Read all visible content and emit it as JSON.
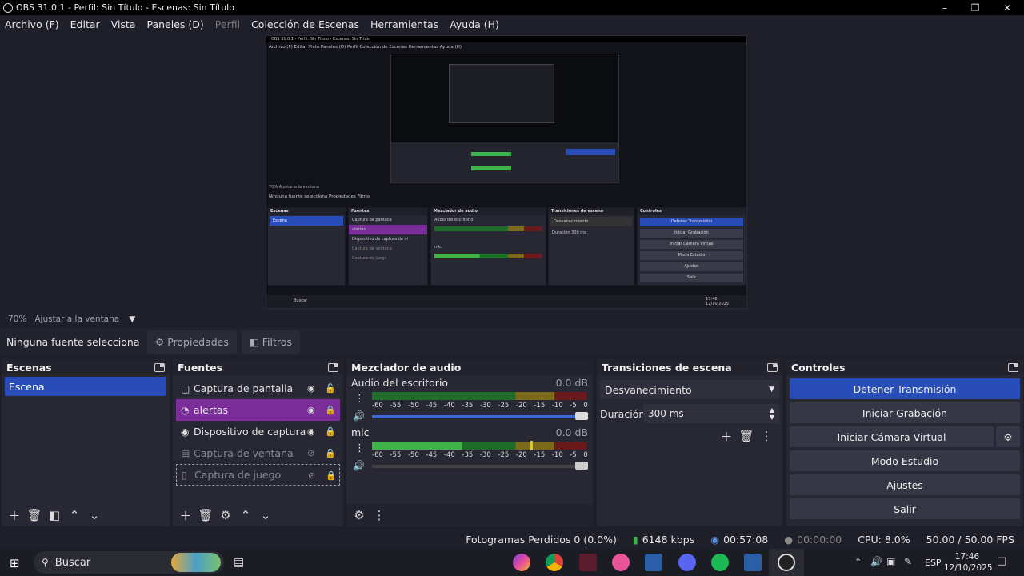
{
  "window": {
    "title": "OBS 31.0.1 - Perfil: Sin Título - Escenas: Sin Título"
  },
  "menu": [
    "Archivo (F)",
    "Editar",
    "Vista",
    "Paneles (D)",
    "Perfil",
    "Colección de Escenas",
    "Herramientas",
    "Ayuda (H)"
  ],
  "menu_disabled_index": 4,
  "preview": {
    "zoom": "70%",
    "fit": "Ajustar a la ventana"
  },
  "source_bar": {
    "label": "Ninguna fuente selecciona",
    "properties": "Propiedades",
    "filters": "Filtros"
  },
  "scenes": {
    "title": "Escenas",
    "items": [
      "Escena"
    ]
  },
  "sources": {
    "title": "Fuentes",
    "items": [
      {
        "label": "Captura de pantalla",
        "icon": "monitor-icon",
        "visible": true,
        "locked": false,
        "selected": false
      },
      {
        "label": "alertas",
        "icon": "globe-icon",
        "visible": true,
        "locked": true,
        "selected": true
      },
      {
        "label": "Dispositivo de captura de vi",
        "icon": "camera-icon",
        "visible": true,
        "locked": true,
        "selected": false
      },
      {
        "label": "Captura de ventana",
        "icon": "window-icon",
        "visible": false,
        "locked": true,
        "selected": false
      },
      {
        "label": "Captura de juego",
        "icon": "gamepad-icon",
        "visible": false,
        "locked": true,
        "selected": false
      }
    ]
  },
  "mixer": {
    "title": "Mezclador de audio",
    "ticks": [
      "-60",
      "-55",
      "-50",
      "-45",
      "-40",
      "-35",
      "-30",
      "-25",
      "-20",
      "-15",
      "-10",
      "-5",
      "0"
    ],
    "channels": [
      {
        "name": "Audio del escritorio",
        "db": "0.0 dB",
        "level": 0.0,
        "volume": 1.0
      },
      {
        "name": "mic",
        "db": "0.0 dB",
        "level": 0.42,
        "volume": 1.0
      }
    ]
  },
  "transitions": {
    "title": "Transiciones de escena",
    "selected": "Desvanecimiento",
    "duration_label": "Duración",
    "duration_value": "300 ms"
  },
  "controls": {
    "title": "Controles",
    "buttons": [
      "Detener Transmisión",
      "Iniciar Grabación",
      "Iniciar Cámara Virtual",
      "Modo Estudio",
      "Ajustes",
      "Salir"
    ]
  },
  "status": {
    "dropped": "Fotogramas Perdidos 0 (0.0%)",
    "bitrate": "6148 kbps",
    "stream_time": "00:57:08",
    "rec_time": "00:00:00",
    "cpu": "CPU: 8.0%",
    "fps": "50.00 / 50.00 FPS"
  },
  "taskbar": {
    "search": "Buscar",
    "lang": "ESP",
    "time": "17:46",
    "date": "12/10/2025"
  },
  "mini": {
    "title": "OBS 31.0.1 - Perfil: Sin Título - Escenas: Sin Título",
    "menu": "Archivo (F)   Editar   Vista   Paneles (D)   Perfil   Colección de Escenas   Herramientas   Ayuda (H)"
  }
}
